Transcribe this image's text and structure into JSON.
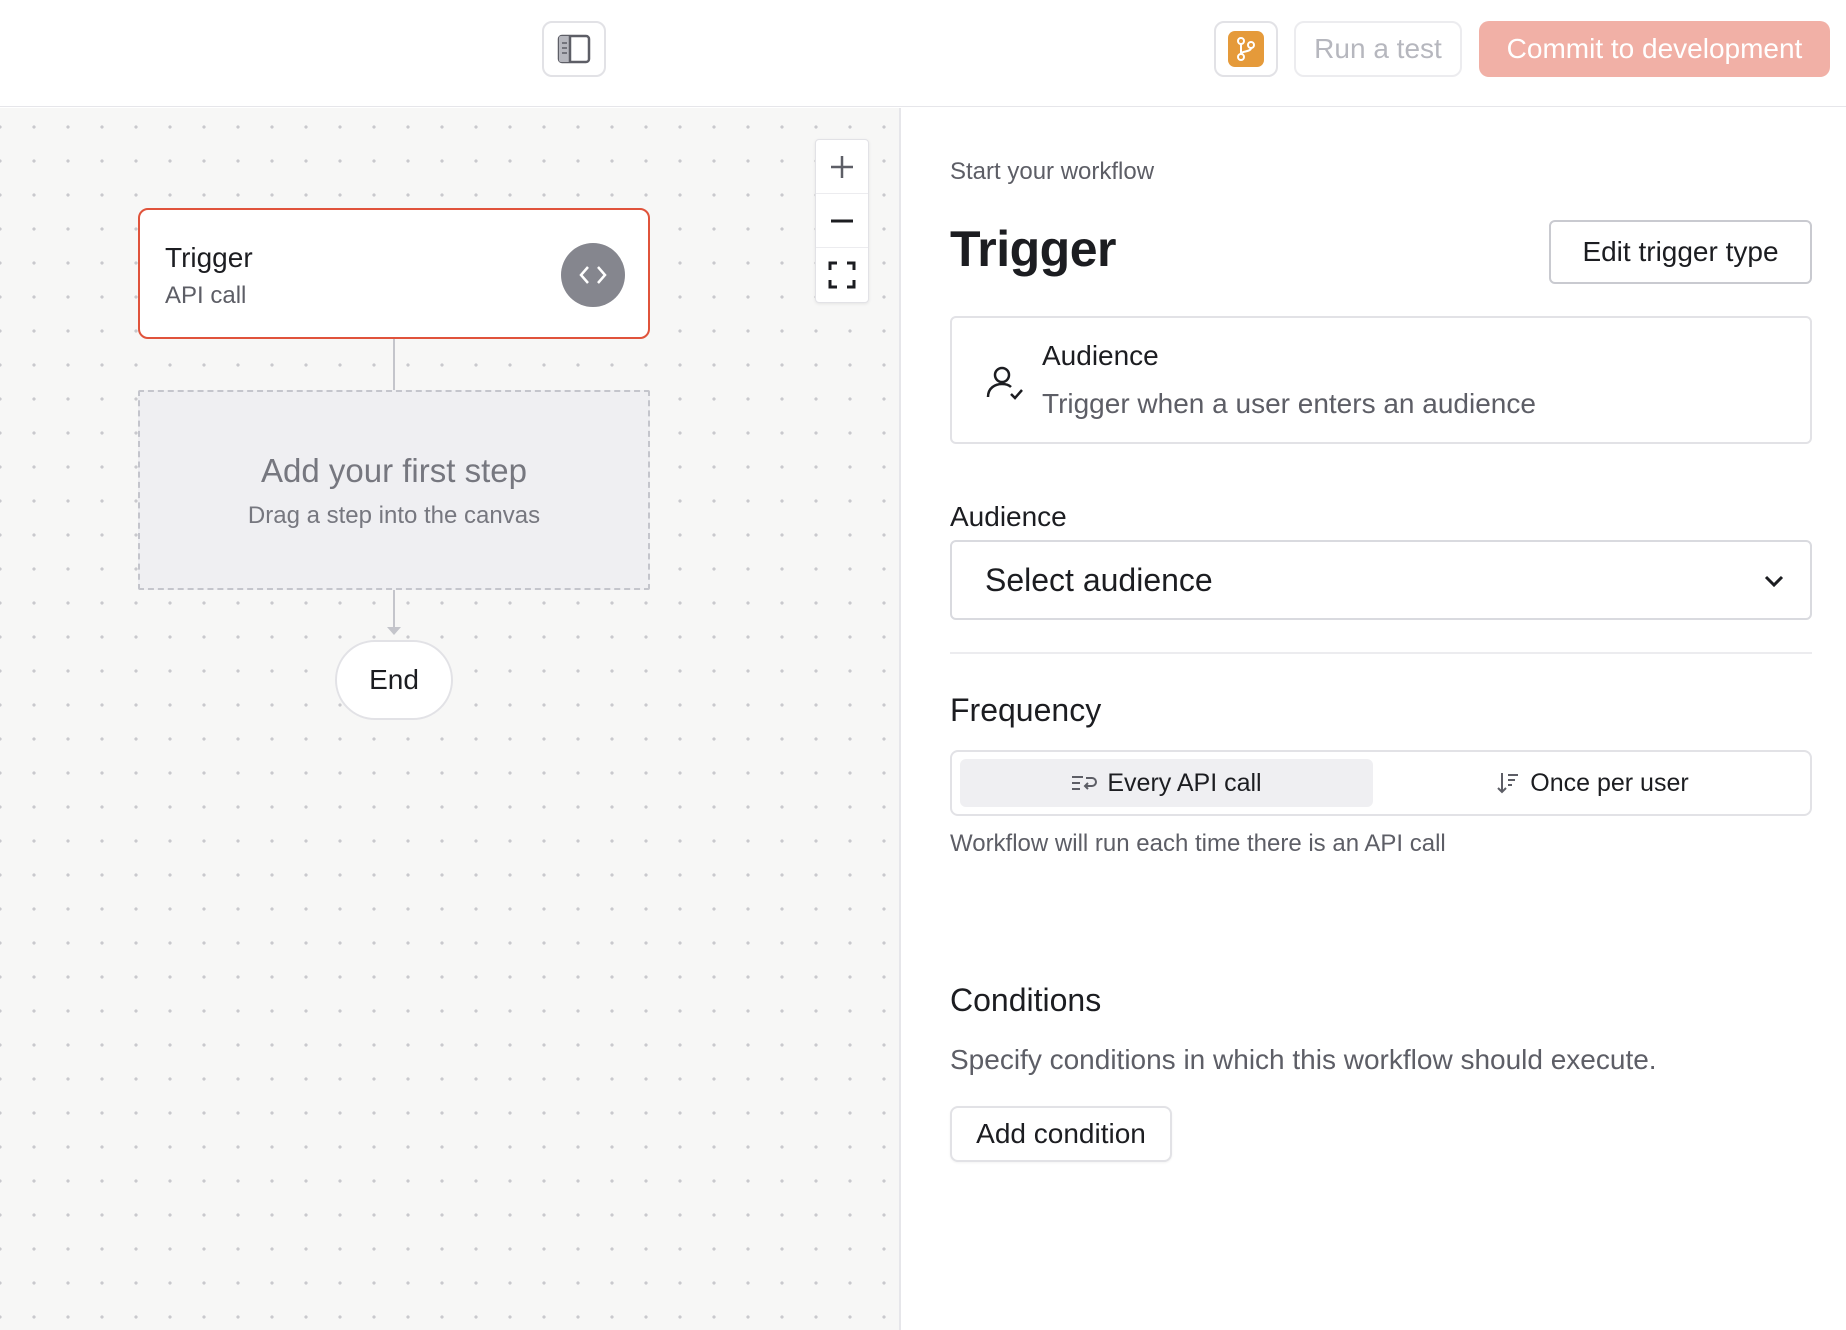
{
  "colors": {
    "accent": "#e0533b",
    "commit_bg": "#f1b0a6",
    "branch_badge": "#e59a3a",
    "muted_text": "#5d5e66"
  },
  "toolbar": {
    "sidebar_toggle_icon": "panel-left-icon",
    "branch_icon": "git-branch-icon",
    "run_test_label": "Run a test",
    "commit_label": "Commit to development"
  },
  "canvas": {
    "zoom_in_icon": "plus-icon",
    "zoom_out_icon": "minus-icon",
    "fit_view_icon": "expand-icon",
    "trigger_node": {
      "title": "Trigger",
      "subtitle": "API call",
      "icon": "code-icon"
    },
    "placeholder_node": {
      "title": "Add your first step",
      "subtitle": "Drag a step into the canvas"
    },
    "end_node": {
      "label": "End"
    }
  },
  "panel": {
    "eyebrow": "Start your workflow",
    "title": "Trigger",
    "edit_trigger_label": "Edit trigger type",
    "trigger_card": {
      "icon": "user-check-icon",
      "title": "Audience",
      "description": "Trigger when a user enters an audience"
    },
    "audience": {
      "label": "Audience",
      "selected": "Select audience"
    },
    "frequency": {
      "title": "Frequency",
      "options": [
        {
          "label": "Every API call",
          "icon": "repeat-list-icon",
          "selected": true
        },
        {
          "label": "Once per user",
          "icon": "sort-down-icon",
          "selected": false
        }
      ],
      "help": "Workflow will run each time there is an API call"
    },
    "conditions": {
      "title": "Conditions",
      "description": "Specify conditions in which this workflow should execute.",
      "add_label": "Add condition"
    }
  }
}
